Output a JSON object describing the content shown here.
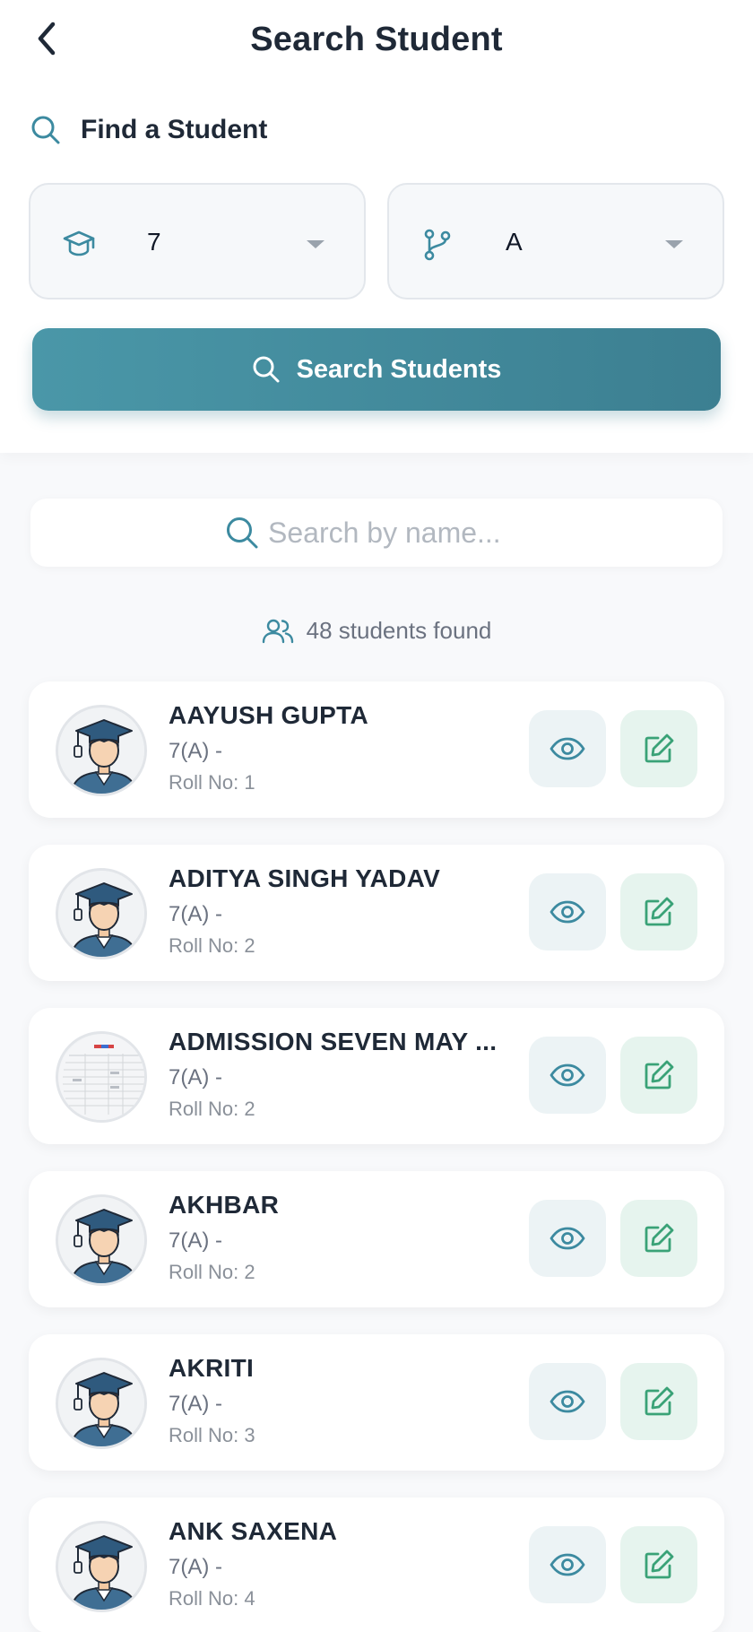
{
  "header": {
    "title": "Search Student",
    "back_icon": "chevron-left-icon"
  },
  "find": {
    "label": "Find a Student"
  },
  "filters": {
    "class_value": "7",
    "section_value": "A"
  },
  "search_button": {
    "label": "Search Students"
  },
  "name_search": {
    "placeholder": "Search by name...",
    "value": ""
  },
  "results": {
    "count_text": "48 students found"
  },
  "colors": {
    "accent": "#3c7f91",
    "view_bg": "#ecf3f5",
    "edit_bg": "#e6f4ee",
    "edit_icon": "#3aa277"
  },
  "students": [
    {
      "name": "AAYUSH GUPTA",
      "class": "7(A) -",
      "roll": "Roll No: 1",
      "avatar": "graduate"
    },
    {
      "name": "ADITYA SINGH YADAV",
      "class": "7(A) -",
      "roll": "Roll No: 2",
      "avatar": "graduate"
    },
    {
      "name": "ADMISSION SEVEN MAY ...",
      "class": "7(A) -",
      "roll": "Roll No: 2",
      "avatar": "document"
    },
    {
      "name": "AKHBAR",
      "class": "7(A) -",
      "roll": "Roll No: 2",
      "avatar": "graduate"
    },
    {
      "name": "AKRITI",
      "class": "7(A) -",
      "roll": "Roll No: 3",
      "avatar": "graduate"
    },
    {
      "name": "ANK SAXENA",
      "class": "7(A) -",
      "roll": "Roll No: 4",
      "avatar": "graduate"
    }
  ]
}
